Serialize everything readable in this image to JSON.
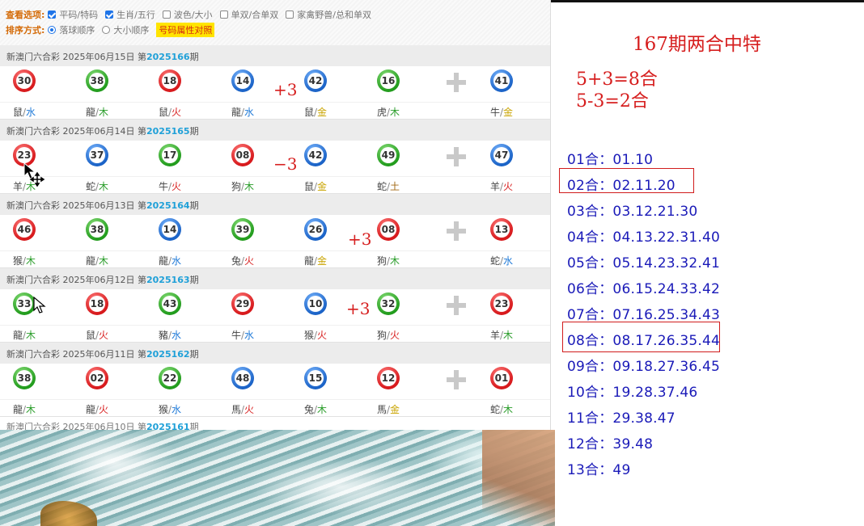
{
  "options": {
    "view_label": "查看选项:",
    "view_items": [
      {
        "label": "平码/特码",
        "checked": true
      },
      {
        "label": "生肖/五行",
        "checked": true
      },
      {
        "label": "波色/大小",
        "checked": false
      },
      {
        "label": "单双/合单双",
        "checked": false
      },
      {
        "label": "家禽野兽/总和单双",
        "checked": false
      }
    ],
    "sort_label": "排序方式:",
    "sort_items": [
      {
        "label": "落球顺序",
        "selected": true
      },
      {
        "label": "大小顺序",
        "selected": false
      }
    ],
    "attr_button": "号码属性对照"
  },
  "draws": [
    {
      "prefix": "新澳门六合彩 2025年06月15日 第",
      "issue": "2025166",
      "suffix": "期",
      "balls": [
        {
          "num": "30",
          "color": "red",
          "zodiac": "鼠",
          "element": "水"
        },
        {
          "num": "38",
          "color": "green",
          "zodiac": "龍",
          "element": "木"
        },
        {
          "num": "18",
          "color": "red",
          "zodiac": "鼠",
          "element": "火"
        },
        {
          "num": "14",
          "color": "blue",
          "zodiac": "龍",
          "element": "水"
        },
        {
          "num": "42",
          "color": "blue",
          "zodiac": "鼠",
          "element": "金"
        },
        {
          "num": "16",
          "color": "green",
          "zodiac": "虎",
          "element": "木"
        },
        {
          "num": "41",
          "color": "blue",
          "zodiac": "牛",
          "element": "金"
        }
      ]
    },
    {
      "prefix": "新澳门六合彩 2025年06月14日 第",
      "issue": "2025165",
      "suffix": "期",
      "balls": [
        {
          "num": "23",
          "color": "red",
          "zodiac": "羊",
          "element": "木"
        },
        {
          "num": "37",
          "color": "blue",
          "zodiac": "蛇",
          "element": "木"
        },
        {
          "num": "17",
          "color": "green",
          "zodiac": "牛",
          "element": "火"
        },
        {
          "num": "08",
          "color": "red",
          "zodiac": "狗",
          "element": "木"
        },
        {
          "num": "42",
          "color": "blue",
          "zodiac": "鼠",
          "element": "金"
        },
        {
          "num": "49",
          "color": "green",
          "zodiac": "蛇",
          "element": "土"
        },
        {
          "num": "47",
          "color": "blue",
          "zodiac": "羊",
          "element": "火"
        }
      ]
    },
    {
      "prefix": "新澳门六合彩 2025年06月13日 第",
      "issue": "2025164",
      "suffix": "期",
      "balls": [
        {
          "num": "46",
          "color": "red",
          "zodiac": "猴",
          "element": "木"
        },
        {
          "num": "38",
          "color": "green",
          "zodiac": "龍",
          "element": "木"
        },
        {
          "num": "14",
          "color": "blue",
          "zodiac": "龍",
          "element": "水"
        },
        {
          "num": "39",
          "color": "green",
          "zodiac": "兔",
          "element": "火"
        },
        {
          "num": "26",
          "color": "blue",
          "zodiac": "龍",
          "element": "金"
        },
        {
          "num": "08",
          "color": "red",
          "zodiac": "狗",
          "element": "木"
        },
        {
          "num": "13",
          "color": "red",
          "zodiac": "蛇",
          "element": "水"
        }
      ]
    },
    {
      "prefix": "新澳门六合彩 2025年06月12日 第",
      "issue": "2025163",
      "suffix": "期",
      "balls": [
        {
          "num": "33",
          "color": "green",
          "zodiac": "龍",
          "element": "木"
        },
        {
          "num": "18",
          "color": "red",
          "zodiac": "鼠",
          "element": "火"
        },
        {
          "num": "43",
          "color": "green",
          "zodiac": "豬",
          "element": "水"
        },
        {
          "num": "29",
          "color": "red",
          "zodiac": "牛",
          "element": "水"
        },
        {
          "num": "10",
          "color": "blue",
          "zodiac": "猴",
          "element": "火"
        },
        {
          "num": "32",
          "color": "green",
          "zodiac": "狗",
          "element": "火"
        },
        {
          "num": "23",
          "color": "red",
          "zodiac": "羊",
          "element": "木"
        }
      ]
    },
    {
      "prefix": "新澳门六合彩 2025年06月11日 第",
      "issue": "2025162",
      "suffix": "期",
      "balls": [
        {
          "num": "38",
          "color": "green",
          "zodiac": "龍",
          "element": "木"
        },
        {
          "num": "02",
          "color": "red",
          "zodiac": "龍",
          "element": "火"
        },
        {
          "num": "22",
          "color": "green",
          "zodiac": "猴",
          "element": "水"
        },
        {
          "num": "48",
          "color": "blue",
          "zodiac": "馬",
          "element": "火"
        },
        {
          "num": "15",
          "color": "blue",
          "zodiac": "兔",
          "element": "木"
        },
        {
          "num": "12",
          "color": "red",
          "zodiac": "馬",
          "element": "金"
        },
        {
          "num": "01",
          "color": "red",
          "zodiac": "蛇",
          "element": "木"
        }
      ]
    }
  ],
  "partial_draw": {
    "prefix": "新澳门六合彩 2025年06月10日 第",
    "issue": "2025161",
    "suffix": "期"
  },
  "annotations": [
    "+3",
    "−3",
    "+3",
    "+3"
  ],
  "right_panel": {
    "title": "167期两合中特",
    "equations": [
      "5+3=8合",
      "5-3=2合"
    ],
    "combos": [
      "01合：01.10",
      "02合：02.11.20",
      "03合：03.12.21.30",
      "04合：04.13.22.31.40",
      "05合：05.14.23.32.41",
      "06合：06.15.24.33.42",
      "07合：07.16.25.34.43",
      "08合：08.17.26.35.44",
      "09合：09.18.27.36.45",
      "10合：19.28.37.46",
      "11合：29.38.47",
      "12合：39.48",
      "13合：49"
    ],
    "highlighted": [
      "02合",
      "08合"
    ],
    "highlight_color": "#d11c1c"
  },
  "colors": {
    "red_ball": "#d7191c",
    "blue_ball": "#1b63c7",
    "green_ball": "#229c1d",
    "issue_blue": "#1fa0d8",
    "annotation_red": "#d61e1e",
    "combo_blue": "#1a1ab8"
  }
}
